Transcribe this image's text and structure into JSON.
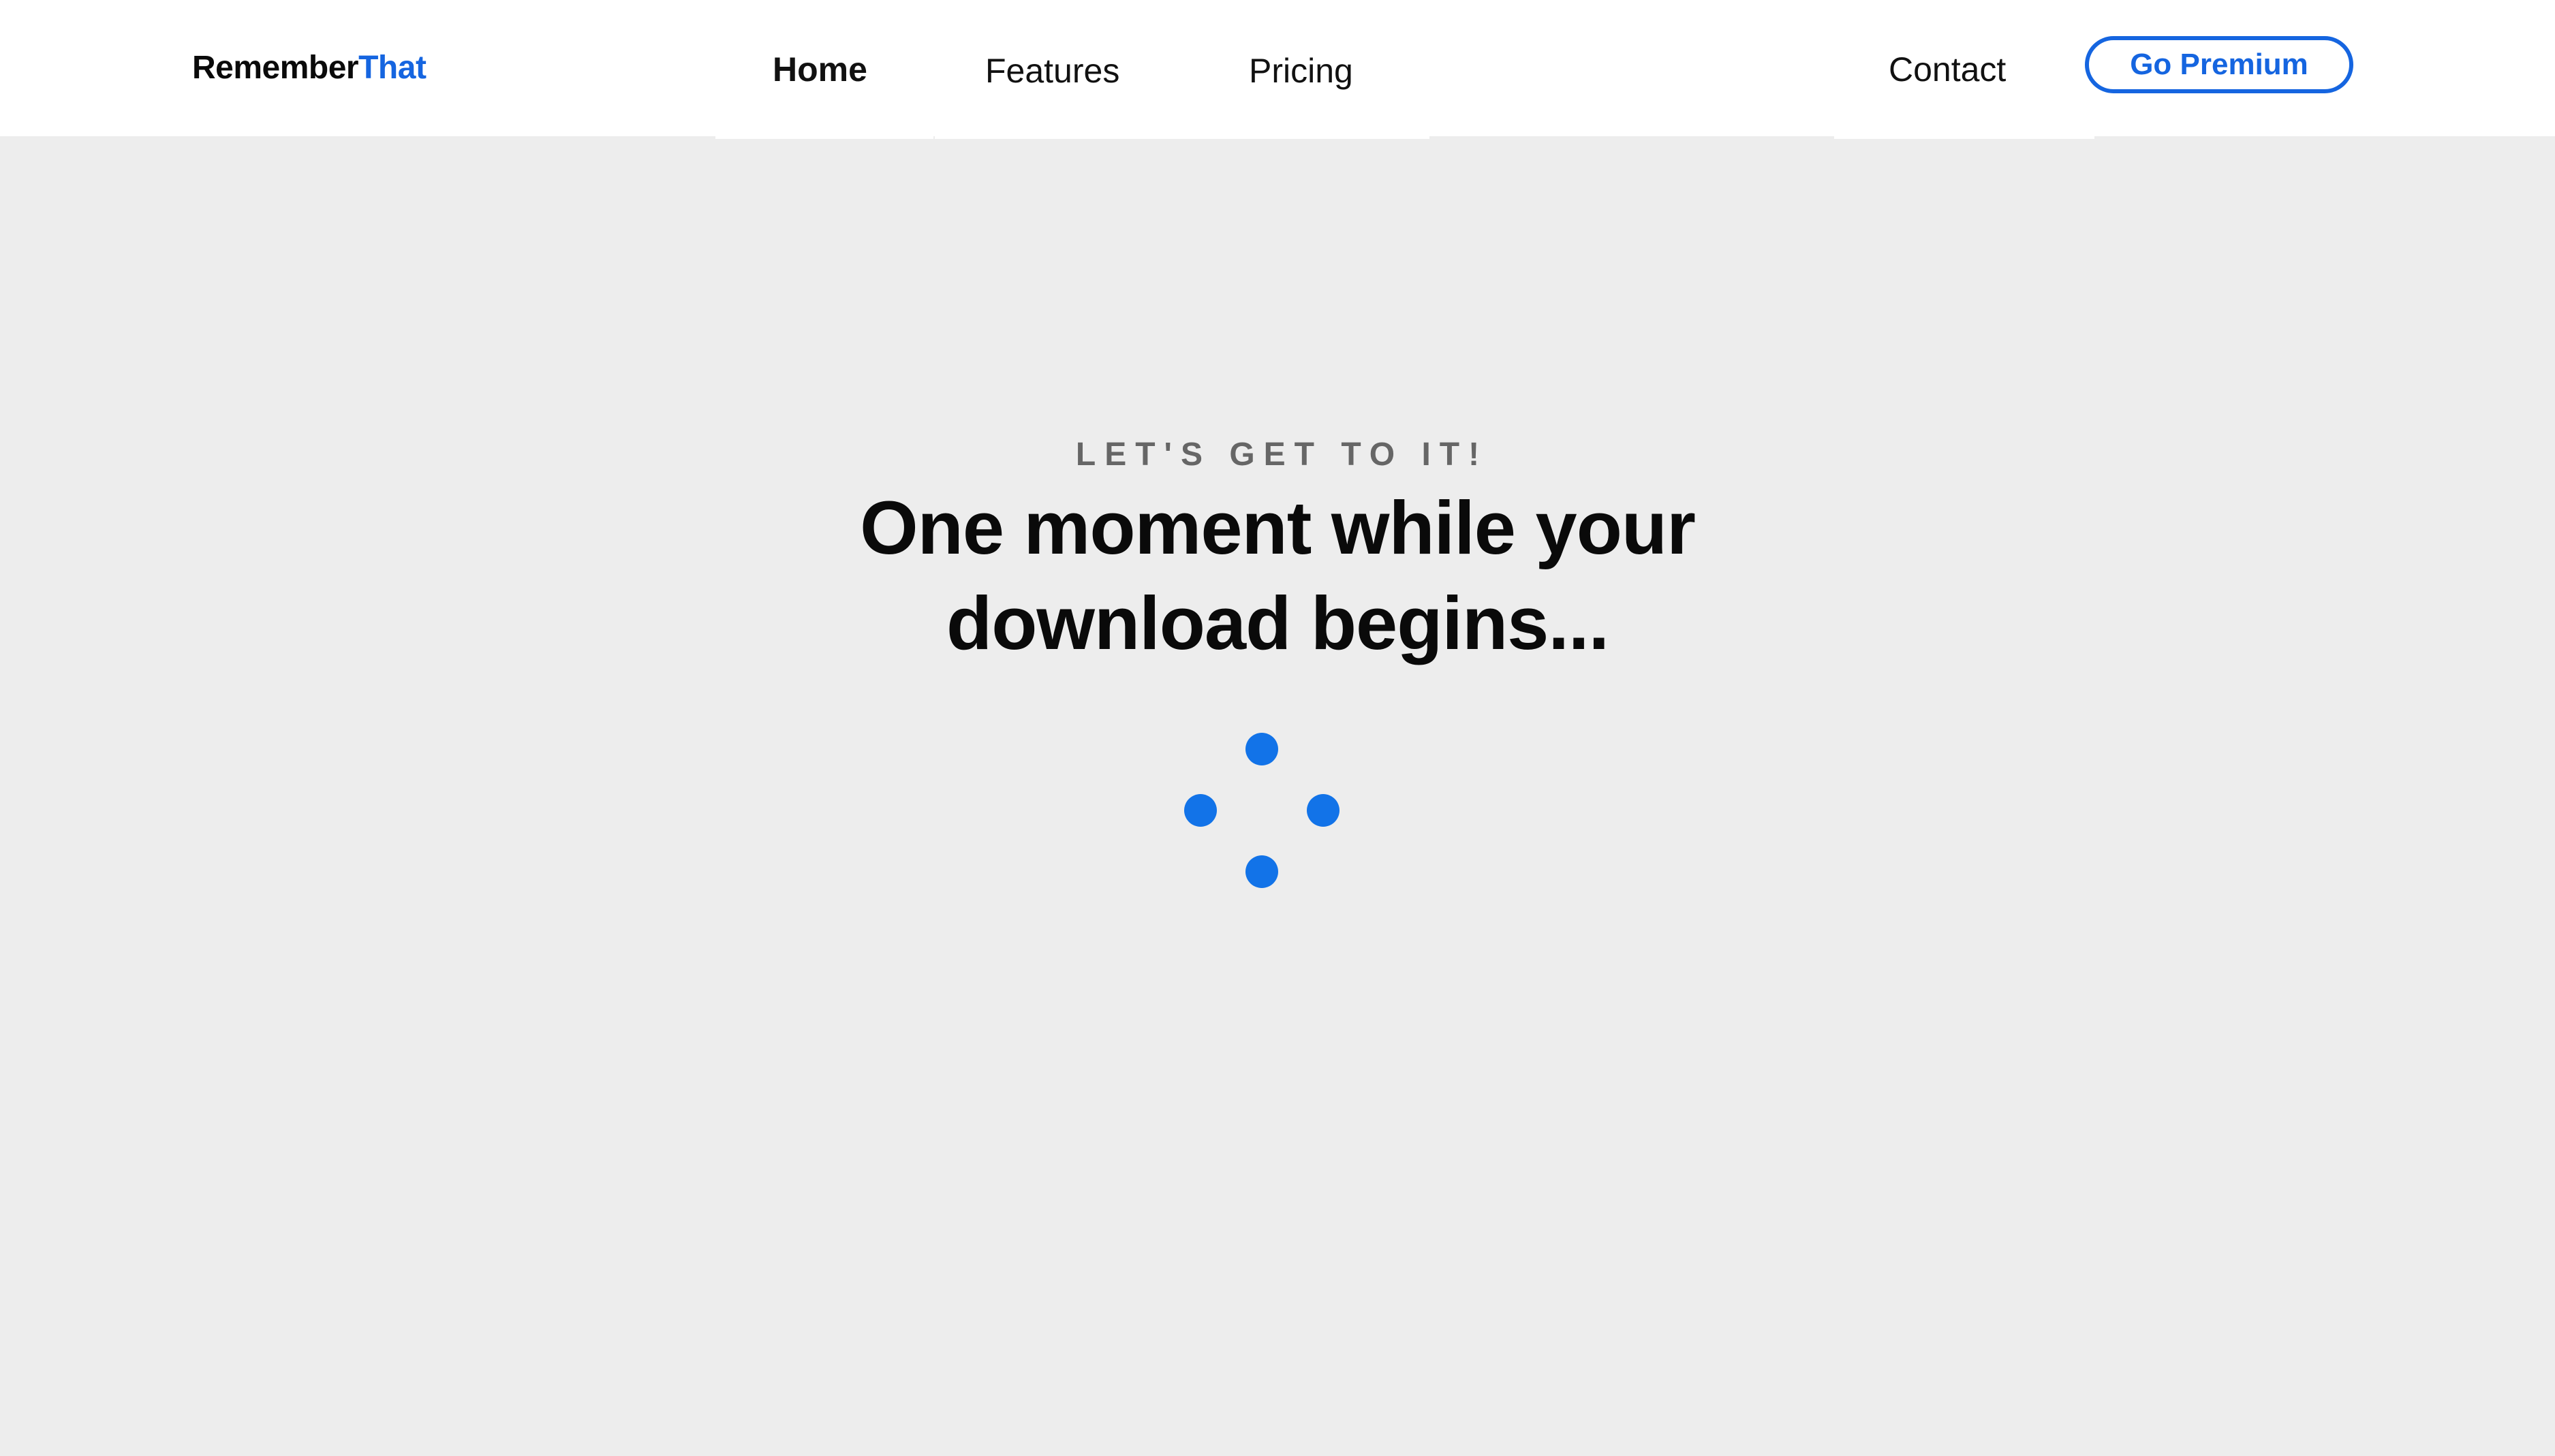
{
  "brand": {
    "name_part1": "Remember",
    "name_part2": "That",
    "accent_color": "#1565e0"
  },
  "nav": {
    "home": "Home",
    "features": "Features",
    "pricing": "Pricing",
    "contact": "Contact",
    "active": "Home"
  },
  "cta": {
    "premium_label": "Go Premium"
  },
  "main": {
    "eyebrow": "LET'S GET TO IT!",
    "headline_line1": "One moment while your",
    "headline_line2": "download begins..."
  },
  "loader": {
    "icon": "loading-spinner-icon",
    "dot_color": "#1273e8",
    "dot_count": 4
  },
  "colors": {
    "page_background": "#ededed",
    "header_background": "#ffffff",
    "text_primary": "#0a0a0a",
    "text_muted": "#666666"
  }
}
